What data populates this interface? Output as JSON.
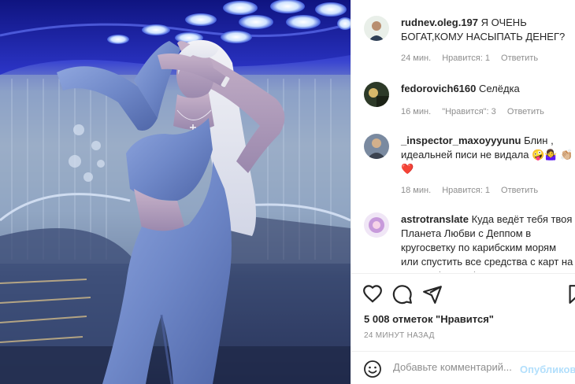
{
  "post": {
    "photo_alt": "post-photo",
    "likes_text": "5 008 отметок \"Нравится\"",
    "posted_time": "24 МИНУТ НАЗАД"
  },
  "comments": [
    {
      "username": "rudnev.oleg.197",
      "text": "Я ОЧЕНЬ БОГАТ,КОМУ НАСЫПАТЬ ДЕНЕГ?",
      "time": "24 мин.",
      "likes": "Нравится: 1",
      "reply": "Ответить"
    },
    {
      "username": "fedorovich6160",
      "text": "Селёдка",
      "time": "16 мин.",
      "likes": "\"Нравится\": 3",
      "reply": "Ответить"
    },
    {
      "username": "_inspector_maxoyyyunu",
      "text": "Блин , идеальней писи не видала 🤪🤷‍♀️ 👏🏼❤️",
      "time": "18 мин.",
      "likes": "Нравится: 1",
      "reply": "Ответить"
    },
    {
      "username": "astrotranslate",
      "text": "Куда ведёт тебя твоя Планета Любви с Деппом в кругосветку по карибским морям или спустить все средства с карт на новые Jimmy Choo? А может всё",
      "time": "",
      "likes": "",
      "reply": ""
    }
  ],
  "actions": {
    "like_icon": "heart-icon",
    "comment_icon": "comment-icon",
    "share_icon": "paper-plane-icon",
    "save_icon": "bookmark-icon"
  },
  "add_comment": {
    "placeholder": "Добавьте комментарий...",
    "publish_label": "Опубликовать",
    "emoji_icon": "smiley-icon"
  },
  "colors": {
    "text": "#262626",
    "muted": "#8e8e8e",
    "publish_disabled": "#b2dffc",
    "border": "#efefef"
  }
}
